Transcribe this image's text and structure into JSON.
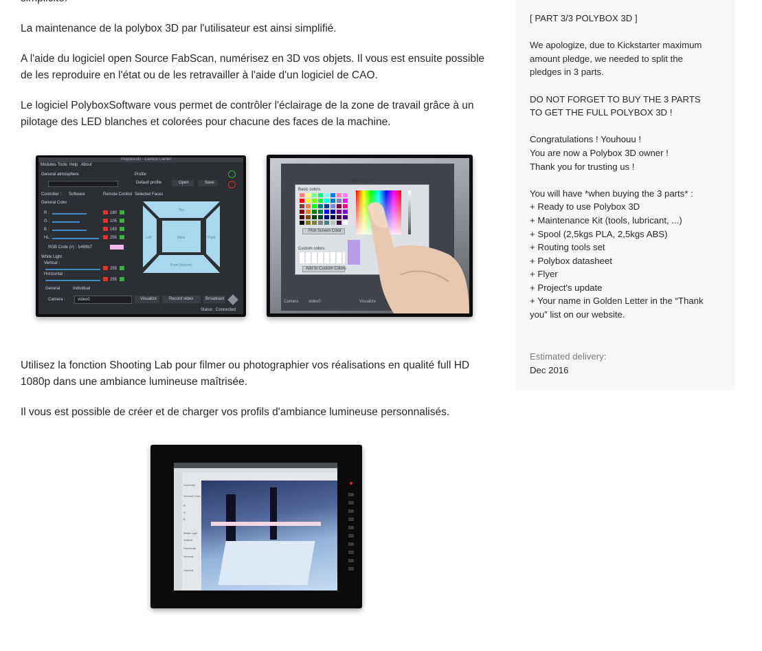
{
  "main": {
    "cut_line": "simplicité.",
    "paragraphs": [
      "La maintenance de la polybox 3D par l'utilisateur est ainsi simplifié.",
      "A l'aide du logiciel open Source FabScan, numérisez en 3D vos objets. Il vous est ensuite possible de les reproduire en l'état ou de les retravailler à l'aide d'un logiciel de CAO.",
      "Le logiciel PolyboxSoftware vous permet de contrôler l'éclairage de la zone de travail grâce à un pilotage des LED blanches et colorées pour chacune des faces de la machine.",
      "Utilisez la fonction Shooting Lab pour filmer ou photographier vos réalisations en qualité full HD 1080p dans une ambiance lumineuse maîtrisée.",
      "Il vous est possible de créer et de charger vos profils d'ambiance lumineuse personnalisés."
    ],
    "screen1": {
      "menu": [
        "Modules",
        "Tools",
        "Help",
        "About"
      ],
      "title": "Polybox3D - Control Center",
      "general_atmosphere": "General atmosphere",
      "profile": "Profile",
      "default_profile": "Default profile",
      "open": "Open",
      "save": "Save",
      "controller": "Controller :",
      "software": "Software",
      "remote_control": "Remote Control",
      "selected_faces": "Selected Faces",
      "general_color": "General Color",
      "channels": [
        {
          "label": "R :",
          "value": "180"
        },
        {
          "label": "G :",
          "value": "105"
        },
        {
          "label": "B :",
          "value": "183"
        },
        {
          "label": "HL :",
          "value": "255"
        }
      ],
      "rgb_code_label": "RGB Code (#) :",
      "rgb_code": "b469b7",
      "white_light": "White Light",
      "vertical": "Vertical :",
      "horizontal": "Horizontal :",
      "vertical_value": "255",
      "horizontal_value": "255",
      "general": "General",
      "individual": "Individual",
      "camera": "Camera :",
      "camera_value": "video0",
      "visualize": "Visualize",
      "record_video": "Record video",
      "broadcast": "Broadcast",
      "status": "Status : Connected",
      "faces": {
        "top": "Top",
        "left": "Left",
        "back": "Back",
        "right": "Right",
        "front": "Front (bottom)"
      },
      "face_color": "#a8d8ee"
    },
    "screen2": {
      "dialog_title": "Select Color",
      "basic_colors": "Basic colors",
      "pick_screen": "Pick Screen Color",
      "custom_colors": "Custom colors",
      "add_custom": "Add to Custom Colors",
      "camera": "Camera",
      "camera_value": "video0",
      "visualize": "Visualize"
    },
    "screen3": {
      "side_labels": [
        "Controller",
        "General Color",
        "R",
        "G",
        "B",
        "White Light",
        "Vertical",
        "Horizontal",
        "General",
        "Camera"
      ]
    }
  },
  "sidebar": {
    "lines": [
      "[ PART 3/3 POLYBOX 3D ]",
      "",
      "We apologize, due to Kickstarter maximum",
      "amount pledge, we needed to split the",
      "pledges in 3 parts.",
      "",
      "DO NOT FORGET TO BUY THE 3 PARTS",
      "TO GET THE FULL POLYBOX 3D !",
      "",
      "Congratulations ! Youhouu !",
      "You are now a Polybox 3D owner !",
      "Thank you for trusting us !",
      "",
      "You will have *when buying the 3 parts* :",
      "+ Ready to use Polybox 3D",
      "+ Maintenance Kit (tools, lubricant, ...)",
      "+ Spool (2,5kgs PLA, 2,5kgs ABS)",
      "+ Routing tools set",
      "+ Polybox datasheet",
      "+ Flyer",
      "+ Project's update",
      "+ Your name in Golden Letter in the “Thank",
      "you” list on our website."
    ],
    "delivery_label": "Estimated delivery:",
    "delivery_value": "Dec 2016"
  },
  "colors": {
    "text": "#282828",
    "muted": "#7a7d80",
    "sidebar_bg": "#f5f7f8",
    "device_frame": "#0d0d0f"
  }
}
